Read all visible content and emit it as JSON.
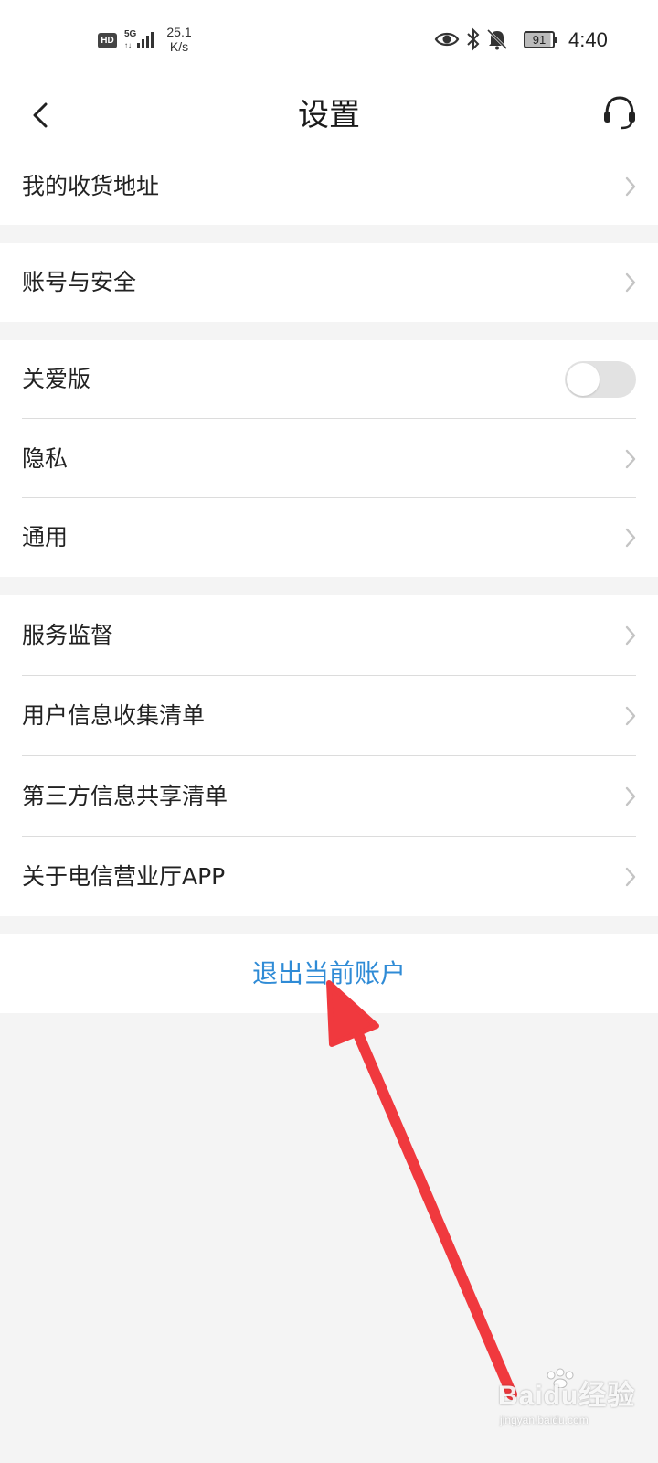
{
  "status_bar": {
    "hd_badge": "HD",
    "network_type": "5G",
    "speed_value": "25.1",
    "speed_unit": "K/s",
    "icons": [
      "eye-icon",
      "bluetooth-icon",
      "bell-off-icon"
    ],
    "battery_level": "91",
    "time": "4:40"
  },
  "nav": {
    "title": "设置",
    "back_icon": "chevron-left-icon",
    "service_icon": "headset-icon"
  },
  "groups": [
    {
      "items": [
        {
          "label": "我的收货地址",
          "control": "chevron"
        }
      ]
    },
    {
      "items": [
        {
          "label": "账号与安全",
          "control": "chevron"
        }
      ]
    },
    {
      "items": [
        {
          "label": "关爱版",
          "control": "toggle",
          "toggle_on": false
        },
        {
          "label": "隐私",
          "control": "chevron"
        },
        {
          "label": "通用",
          "control": "chevron"
        }
      ]
    },
    {
      "items": [
        {
          "label": "服务监督",
          "control": "chevron"
        },
        {
          "label": "用户信息收集清单",
          "control": "chevron"
        },
        {
          "label": "第三方信息共享清单",
          "control": "chevron"
        },
        {
          "label": "关于电信营业厅APP",
          "control": "chevron"
        }
      ]
    }
  ],
  "logout": {
    "label": "退出当前账户",
    "color": "#2f8bd6"
  },
  "annotation": {
    "arrow_color": "#f0393e"
  },
  "watermark": {
    "text": "Baidu经验",
    "url": "jingyan.baidu.com"
  },
  "colors": {
    "background": "#f4f4f4",
    "surface": "#ffffff",
    "divider": "#dcdcdc"
  }
}
